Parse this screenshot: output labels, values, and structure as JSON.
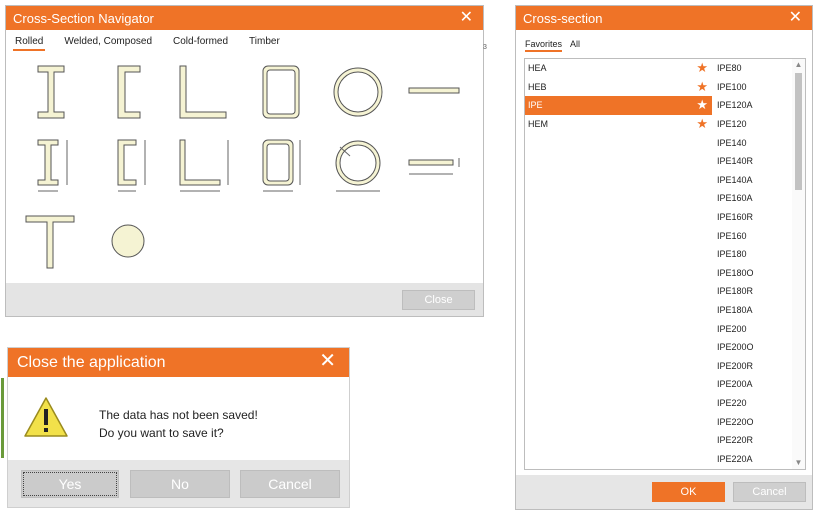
{
  "navigator": {
    "title": "Cross-Section Navigator",
    "tabs": [
      "Rolled",
      "Welded, Composed",
      "Cold-formed",
      "Timber"
    ],
    "active_tab": "Rolled",
    "close_label": "Close",
    "shape_icons": [
      "i-beam-icon",
      "channel-icon",
      "angle-icon",
      "rectangular-hollow-icon",
      "circular-hollow-icon",
      "flat-bar-icon",
      "i-beam-dimensioned-icon",
      "channel-dimensioned-icon",
      "angle-dimensioned-icon",
      "rectangular-hollow-dimensioned-icon",
      "circular-hollow-dimensioned-icon",
      "flat-bar-dimensioned-icon",
      "t-section-icon",
      "round-bar-icon"
    ]
  },
  "close_dialog": {
    "title": "Close the application",
    "line1": "The data has not been saved!",
    "line2": "Do you want to save it?",
    "yes_label": "Yes",
    "no_label": "No",
    "cancel_label": "Cancel"
  },
  "cross_section": {
    "title": "Cross-section",
    "tabs": [
      "Favorites",
      "All"
    ],
    "active_tab": "Favorites",
    "favorites": [
      {
        "label": "HEA",
        "selected": false
      },
      {
        "label": "HEB",
        "selected": false
      },
      {
        "label": "IPE",
        "selected": true
      },
      {
        "label": "HEM",
        "selected": false
      }
    ],
    "sizes": [
      "IPE80",
      "IPE100",
      "IPE120A",
      "IPE120",
      "IPE140",
      "IPE140R",
      "IPE140A",
      "IPE160A",
      "IPE160R",
      "IPE160",
      "IPE180",
      "IPE180O",
      "IPE180R",
      "IPE180A",
      "IPE200",
      "IPE200O",
      "IPE200R",
      "IPE200A",
      "IPE220",
      "IPE220O",
      "IPE220R",
      "IPE220A"
    ],
    "ok_label": "OK",
    "cancel_label": "Cancel"
  },
  "colors": {
    "accent": "#ef7327",
    "shape_fill": "#f5f3d3",
    "shape_stroke": "#555555"
  }
}
